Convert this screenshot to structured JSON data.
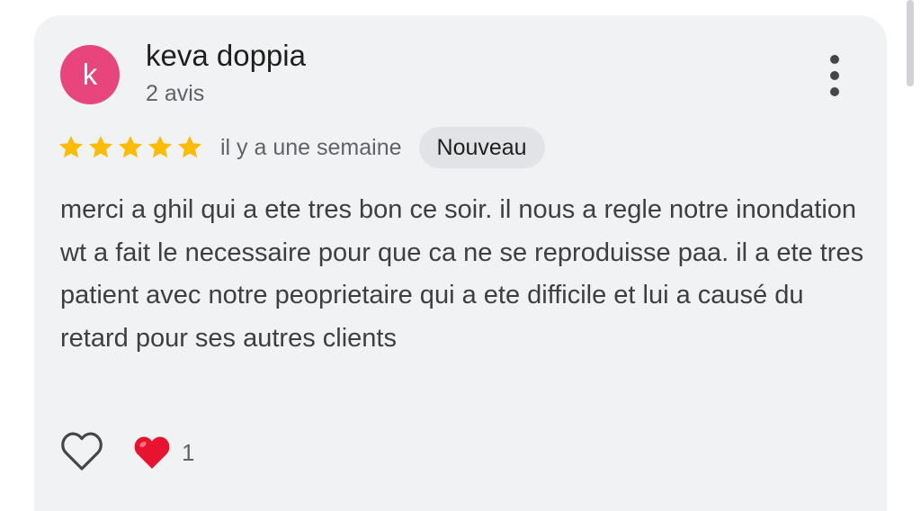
{
  "review": {
    "author_initial": "k",
    "author_name": "keva doppia",
    "author_reviews_count": "2 avis",
    "rating": 5,
    "rating_max": 5,
    "date": "il y a une semaine",
    "badge": "Nouveau",
    "text": "merci a ghil qui a ete tres bon ce soir. il nous a regle notre inondation wt a fait le necessaire pour que ca ne se reproduisse paa. il a ete tres patient avec notre peoprietaire qui a ete difficile et lui a causé du retard pour ses autres clients",
    "reaction_count": "1"
  },
  "icons": {
    "more": "more-vertical-icon",
    "star": "star-icon",
    "like": "heart-outline-icon",
    "reaction": "red-heart-emoji-icon"
  },
  "colors": {
    "avatar": "#e9457d",
    "star": "#fbbc04",
    "card_background": "#f1f2f4",
    "badge_background": "#e1e3e6",
    "reaction_heart": "#e8132f"
  }
}
